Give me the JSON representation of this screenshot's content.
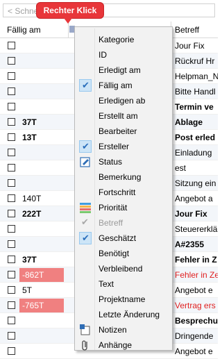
{
  "search": {
    "placeholder": "< Schne"
  },
  "callout": {
    "text": "Rechter Klick"
  },
  "header": {
    "col_due": "Fällig am",
    "col_subject": "Betreff"
  },
  "rows": [
    {
      "due": "",
      "due_style": "",
      "subject": "Jour Fix",
      "subject_style": ""
    },
    {
      "due": "",
      "due_style": "",
      "subject": "Rückruf Hr",
      "subject_style": ""
    },
    {
      "due": "",
      "due_style": "",
      "subject": "Helpman_N",
      "subject_style": ""
    },
    {
      "due": "",
      "due_style": "",
      "subject": "Bitte Handl",
      "subject_style": ""
    },
    {
      "due": "",
      "due_style": "",
      "subject": "Termin ve",
      "subject_style": "bold"
    },
    {
      "due": "37T",
      "due_style": "bold",
      "subject": "Ablage",
      "subject_style": "bold"
    },
    {
      "due": "13T",
      "due_style": "bold",
      "subject": "Post erled",
      "subject_style": "bold"
    },
    {
      "due": "",
      "due_style": "",
      "subject": "Einladung",
      "subject_style": ""
    },
    {
      "due": "",
      "due_style": "",
      "subject": "est",
      "subject_style": ""
    },
    {
      "due": "",
      "due_style": "",
      "subject": "Sitzung ein",
      "subject_style": ""
    },
    {
      "due": "140T",
      "due_style": "",
      "subject": "Angebot a",
      "subject_style": ""
    },
    {
      "due": "222T",
      "due_style": "bold",
      "subject": "Jour Fix",
      "subject_style": "bold"
    },
    {
      "due": "",
      "due_style": "",
      "subject": "Steuererklä",
      "subject_style": ""
    },
    {
      "due": "",
      "due_style": "",
      "subject": "A#2355",
      "subject_style": "bold"
    },
    {
      "due": "37T",
      "due_style": "bold",
      "subject": "Fehler in Z",
      "subject_style": "bold"
    },
    {
      "due": "-862T",
      "due_style": "red",
      "subject": "Fehler in Ze",
      "subject_style": "redtext"
    },
    {
      "due": "5T",
      "due_style": "",
      "subject": "Angebot e",
      "subject_style": ""
    },
    {
      "due": "-765T",
      "due_style": "red",
      "subject": "Vertrag ers",
      "subject_style": "redtext"
    },
    {
      "due": "",
      "due_style": "",
      "subject": "Besprechu",
      "subject_style": "bold"
    },
    {
      "due": "",
      "due_style": "",
      "subject": "Dringende",
      "subject_style": ""
    },
    {
      "due": "",
      "due_style": "",
      "subject": "Angebot e",
      "subject_style": ""
    }
  ],
  "menu": {
    "items": [
      {
        "label": "Kategorie",
        "state": "",
        "icon": ""
      },
      {
        "label": "ID",
        "state": "",
        "icon": ""
      },
      {
        "label": "Erledigt am",
        "state": "",
        "icon": ""
      },
      {
        "label": "Fällig am",
        "state": "checked",
        "icon": ""
      },
      {
        "label": "Erledigen ab",
        "state": "",
        "icon": ""
      },
      {
        "label": "Erstellt am",
        "state": "",
        "icon": ""
      },
      {
        "label": "Bearbeiter",
        "state": "",
        "icon": ""
      },
      {
        "label": "Ersteller",
        "state": "checked",
        "icon": ""
      },
      {
        "label": "Status",
        "state": "",
        "icon": "status-icon"
      },
      {
        "label": "Bemerkung",
        "state": "",
        "icon": ""
      },
      {
        "label": "Fortschritt",
        "state": "",
        "icon": ""
      },
      {
        "label": "Priorität",
        "state": "",
        "icon": "priority-icon"
      },
      {
        "label": "Betreff",
        "state": "disabled-checked",
        "icon": ""
      },
      {
        "label": "Geschätzt",
        "state": "checked",
        "icon": ""
      },
      {
        "label": "Benötigt",
        "state": "",
        "icon": ""
      },
      {
        "label": "Verbleibend",
        "state": "",
        "icon": ""
      },
      {
        "label": "Text",
        "state": "",
        "icon": ""
      },
      {
        "label": "Projektname",
        "state": "",
        "icon": ""
      },
      {
        "label": "Letzte Änderung",
        "state": "",
        "icon": ""
      },
      {
        "label": "Notizen",
        "state": "",
        "icon": "notes-icon"
      },
      {
        "label": "Anhänge",
        "state": "",
        "icon": "paperclip-icon"
      }
    ]
  }
}
